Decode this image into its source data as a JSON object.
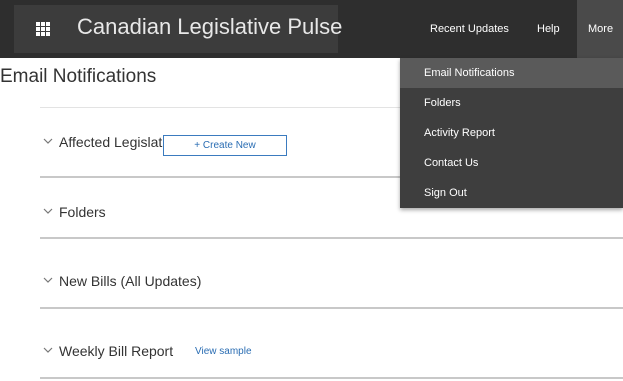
{
  "app": {
    "title": "Canadian Legislative Pulse",
    "menu_icon": "grid-icon"
  },
  "nav": {
    "recent_updates": "Recent Updates",
    "help": "Help",
    "more": "More"
  },
  "dropdown": {
    "items": [
      {
        "label": "Email Notifications",
        "active": true
      },
      {
        "label": "Folders"
      },
      {
        "label": "Activity Report"
      },
      {
        "label": "Contact Us"
      },
      {
        "label": "Sign Out"
      }
    ]
  },
  "page": {
    "title": "Email Notifications"
  },
  "sections": [
    {
      "label": "Affected Legislation",
      "action": "+ Create New",
      "icon": "chevron-down-icon"
    },
    {
      "label": "Folders",
      "icon": "chevron-down-icon"
    },
    {
      "label": "New Bills (All Updates)",
      "icon": "chevron-down-icon"
    },
    {
      "label": "Weekly Bill Report",
      "link": "View sample",
      "icon": "chevron-down-icon"
    }
  ],
  "colors": {
    "topbar": "#2e2e2e",
    "brand_panel": "#3c3c3c",
    "dropdown": "#3e3e3e",
    "dropdown_active": "#5a5a5a",
    "link": "#2a6db3"
  }
}
